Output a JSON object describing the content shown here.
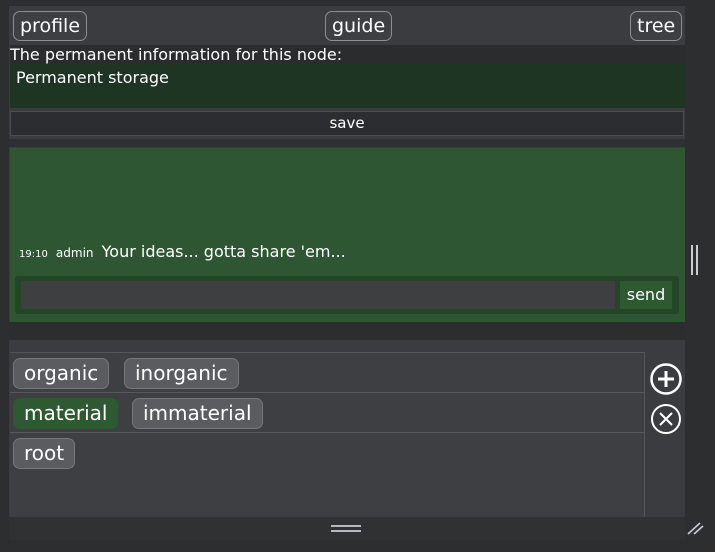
{
  "nav": {
    "profile": "profile",
    "guide": "guide",
    "tree": "tree"
  },
  "permanent": {
    "label": "The permanent information for this node:",
    "value": "Permanent storage",
    "save": "save"
  },
  "chat": {
    "messages": [
      {
        "time": "19:10",
        "user": "admin",
        "text": "Your ideas... gotta share 'em..."
      }
    ],
    "input_value": "",
    "send": "send"
  },
  "tags": {
    "rows": [
      [
        "organic",
        "inorganic"
      ],
      [
        "material",
        "immaterial"
      ],
      [
        "root"
      ]
    ],
    "active": "material"
  },
  "icons": {
    "add": "plus-circle-icon",
    "remove": "close-circle-icon",
    "grip": "drag-handle-icon",
    "resize": "resize-corner-icon"
  },
  "colors": {
    "accent_green": "#2d5a31",
    "dark_green": "#1f3524",
    "background": "#2c2e30"
  }
}
